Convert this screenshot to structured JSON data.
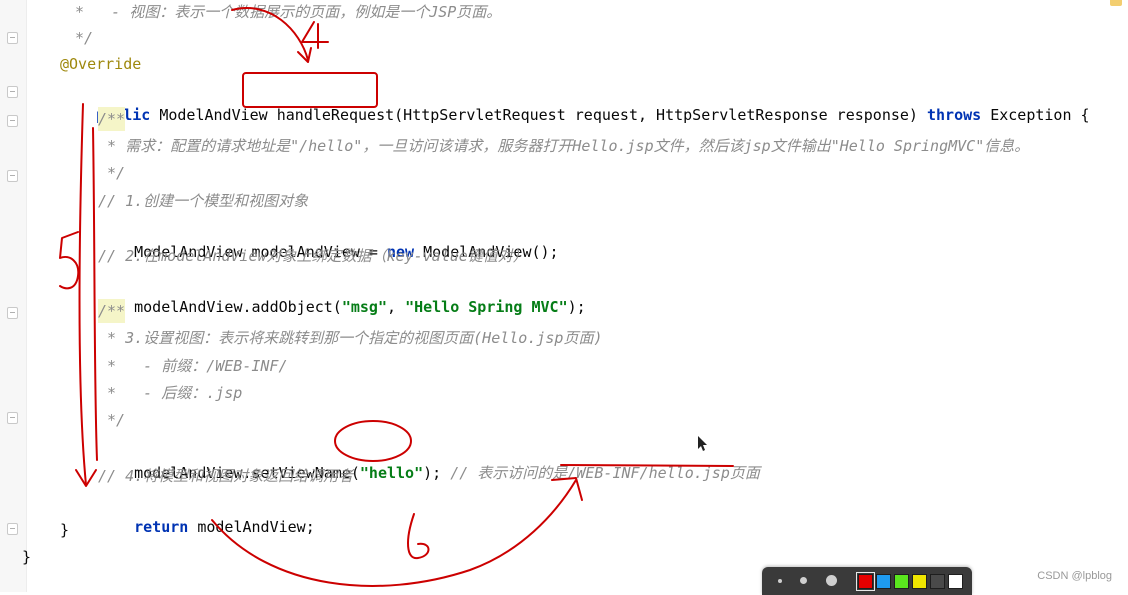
{
  "editor": {
    "lines": [
      {
        "text": " *   - 视图：表示一个数据展示的页面，例如是一个JSP页面。",
        "kind": "comment"
      },
      {
        "text": " */",
        "kind": "comment"
      },
      {
        "text": "@Override",
        "kind": "annotation"
      },
      {
        "kind": "method-signature",
        "parts": [
          "public",
          " ModelAndView ",
          "handleRequest",
          "(HttpServletRequest request, HttpServletResponse response) ",
          "throws",
          " Exception {"
        ]
      },
      {
        "text": "/**",
        "kind": "doc-start"
      },
      {
        "text": " * 需求：配置的请求地址是\"/hello\"，一旦访问该请求，服务器打开Hello.jsp文件，然后该jsp文件输出\"Hello SpringMVC\"信息。",
        "kind": "comment"
      },
      {
        "text": " */",
        "kind": "comment"
      },
      {
        "text": "// 1.创建一个模型和视图对象",
        "kind": "comment"
      },
      {
        "kind": "new-statement",
        "parts": [
          "ModelAndView modelAndView = ",
          "new",
          " ModelAndView();"
        ]
      },
      {
        "text": "// 2.在modelAndView对象上绑定数据（key-value键值对）",
        "kind": "comment"
      },
      {
        "kind": "add-object",
        "parts": [
          "modelAndView.addObject(",
          "\"msg\"",
          ", ",
          "\"Hello Spring MVC\"",
          ");"
        ]
      },
      {
        "text": "/**",
        "kind": "doc-start"
      },
      {
        "text": " * 3.设置视图：表示将来跳转到那一个指定的视图页面(Hello.jsp页面)",
        "kind": "comment"
      },
      {
        "text": " *   - 前缀：/WEB-INF/",
        "kind": "comment"
      },
      {
        "text": " *   - 后缀：.jsp",
        "kind": "comment"
      },
      {
        "text": " */",
        "kind": "comment"
      },
      {
        "kind": "set-view",
        "parts": [
          "modelAndView.setViewName(",
          "\"hello\"",
          "); ",
          "// 表示访问的是/WEB-INF/hello.jsp页面"
        ]
      },
      {
        "text": "// 4.将模型和视图对象返回给调用者",
        "kind": "comment"
      },
      {
        "kind": "return",
        "parts": [
          "return",
          " modelAndView;"
        ]
      },
      {
        "text": "}",
        "kind": "plain"
      },
      {
        "text": "}",
        "kind": "plain"
      }
    ]
  },
  "annotations": {
    "numbers": [
      "4",
      "5",
      "6"
    ],
    "colors": {
      "ink": "#cc0000"
    }
  },
  "toolbar": {
    "colors": [
      "#e60000",
      "#1e9bf0",
      "#5ae61e",
      "#f0e600",
      "#4a4a4a",
      "#ffffff"
    ]
  },
  "watermark": "CSDN @lpblog",
  "theme": {
    "keyword": "#0033b3",
    "string": "#067d17",
    "comment": "#8c8c8c",
    "annotation": "#9e880d"
  }
}
